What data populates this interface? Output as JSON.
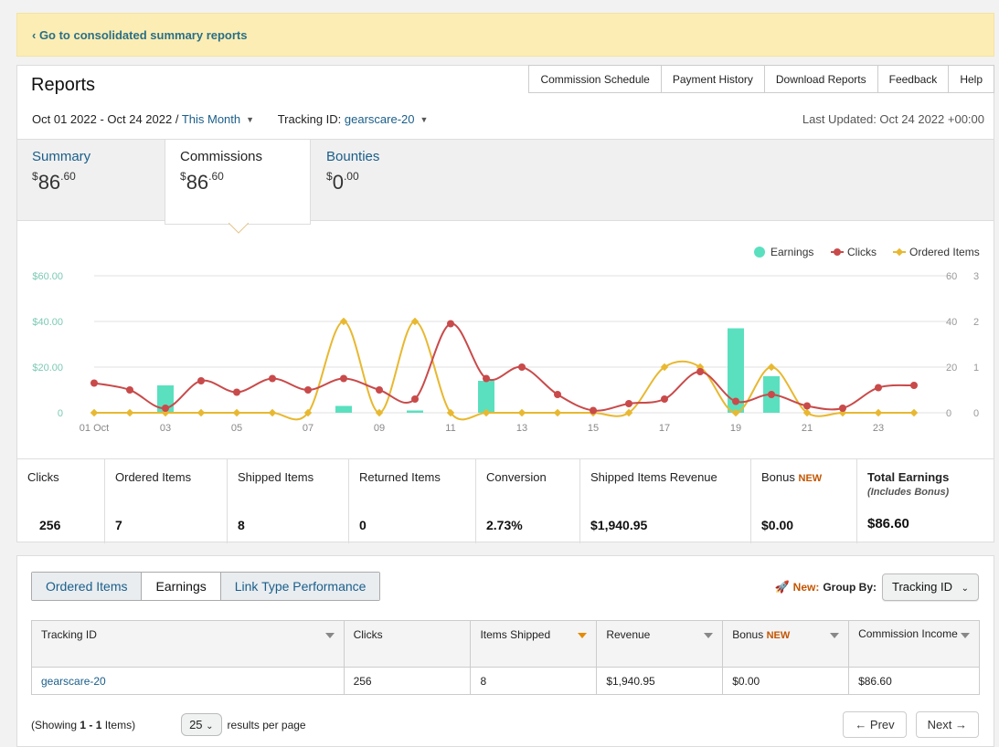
{
  "banner": {
    "link_text": "‹ Go to consolidated summary reports"
  },
  "header": {
    "title": "Reports",
    "nav": [
      "Commission Schedule",
      "Payment History",
      "Download Reports",
      "Feedback",
      "Help"
    ],
    "date_range": "Oct 01 2022 - Oct 24 2022 /",
    "date_preset": "This Month",
    "tracking_label": "Tracking ID:",
    "tracking_value": "gearscare-20",
    "last_updated": "Last Updated: Oct 24 2022 +00:00"
  },
  "summary_tabs": [
    {
      "label": "Summary",
      "currency": "$",
      "whole": "86",
      "cents": ".60"
    },
    {
      "label": "Commissions",
      "currency": "$",
      "whole": "86",
      "cents": ".60"
    },
    {
      "label": "Bounties",
      "currency": "$",
      "whole": "0",
      "cents": ".00"
    }
  ],
  "chart_data": {
    "type": "bar+line",
    "legend": [
      "Earnings",
      "Clicks",
      "Ordered Items"
    ],
    "legend_position": "top-right",
    "x_labels": [
      "01 Oct",
      "03",
      "05",
      "07",
      "09",
      "11",
      "13",
      "15",
      "17",
      "19",
      "21",
      "23"
    ],
    "days": [
      1,
      2,
      3,
      4,
      5,
      6,
      7,
      8,
      9,
      10,
      11,
      12,
      13,
      14,
      15,
      16,
      17,
      18,
      19,
      20,
      21,
      22,
      23,
      24
    ],
    "y_left_ticks": [
      "$60.00",
      "$40.00",
      "$20.00",
      "0"
    ],
    "y_mid_ticks": [
      "60",
      "40",
      "20",
      "0"
    ],
    "y_right_ticks": [
      "3",
      "2",
      "1",
      "0"
    ],
    "earnings": [
      0,
      0,
      12,
      0,
      0,
      0,
      0,
      3,
      0,
      1,
      0,
      14,
      0,
      0,
      0,
      0,
      0,
      0,
      37,
      16,
      0,
      0,
      0,
      0
    ],
    "clicks": [
      13,
      10,
      2,
      14,
      9,
      15,
      10,
      15,
      10,
      6,
      39,
      15,
      20,
      8,
      1,
      4,
      6,
      18,
      5,
      8,
      3,
      2,
      11,
      12
    ],
    "ordered_items": [
      0,
      0,
      0,
      0,
      0,
      0,
      0,
      2,
      0,
      2,
      0,
      0,
      0,
      0,
      0,
      0,
      1,
      1,
      0,
      1,
      0,
      0,
      0,
      0
    ],
    "colors": {
      "earnings": "#5ae0bf",
      "clicks": "#c94a4a",
      "ordered_items": "#e8b830",
      "grid": "#e2e2e2",
      "left_axis": "#7cc9b5"
    },
    "ylim_earnings": [
      0,
      60
    ],
    "ylim_clicks": [
      0,
      60
    ],
    "ylim_items": [
      0,
      3
    ],
    "grid": true
  },
  "stats": [
    {
      "label": "Clicks",
      "value": "256"
    },
    {
      "label": "Ordered Items",
      "value": "7"
    },
    {
      "label": "Shipped Items",
      "value": "8"
    },
    {
      "label": "Returned Items",
      "value": "0"
    },
    {
      "label": "Conversion",
      "value": "2.73%"
    },
    {
      "label": "Shipped Items Revenue",
      "value": "$1,940.95"
    },
    {
      "label": "Bonus",
      "badge": "NEW",
      "value": "$0.00"
    },
    {
      "label": "Total Earnings",
      "sublabel": "(Includes Bonus)",
      "value": "$86.60"
    }
  ],
  "bottom": {
    "tabs": [
      "Ordered Items",
      "Earnings",
      "Link Type Performance"
    ],
    "new_label": "New:",
    "group_by_label": "Group By:",
    "group_by_value": "Tracking ID",
    "columns": [
      "Tracking ID",
      "Clicks",
      "Items Shipped",
      "Revenue",
      "Bonus",
      "Commission Income"
    ],
    "bonus_badge": "NEW",
    "row": [
      "gearscare-20",
      "256",
      "8",
      "$1,940.95",
      "$0.00",
      "$86.60"
    ],
    "showing_prefix": "(Showing ",
    "showing_range": "1 - 1",
    "showing_suffix": " Items)",
    "per_page": "25",
    "per_page_label": "results per page",
    "prev": "← Prev",
    "next": "Next →"
  }
}
